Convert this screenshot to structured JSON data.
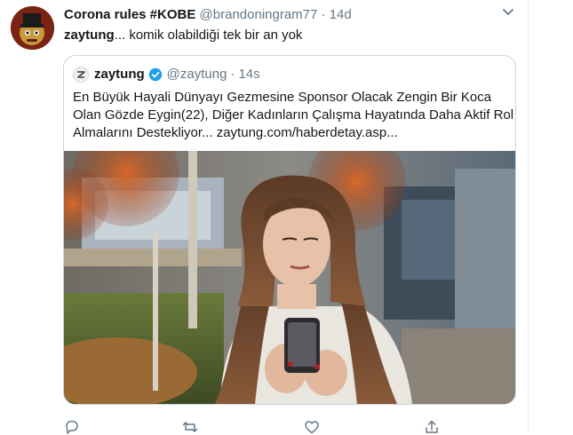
{
  "tweet": {
    "author_name": "Corona rules #KOBE",
    "author_handle": "@brandoningram77",
    "separator": "·",
    "time": "14d",
    "text_mention": "zaytung",
    "text_rest": "... komik olabildiği tek bir an yok"
  },
  "quoted": {
    "name": "zaytung",
    "handle": "@zaytung",
    "separator": "·",
    "time": "14s",
    "lines": [
      "En Büyük Hayali Dünyayı Gezmesine Sponsor Olacak Zengin Bir Koca",
      "Olan Gözde Eygin(22), Diğer Kadınların Çalışma Hayatında Daha Aktif Rol",
      "Almalarını Destekliyor... zaytung.com/haberdetay.asp..."
    ]
  },
  "icons": {
    "menu": "chevron-down-icon",
    "reply": "reply-icon",
    "retweet": "retweet-icon",
    "like": "like-icon",
    "share": "share-icon",
    "verified": "verified-badge-icon"
  },
  "colors": {
    "text": "#14171a",
    "secondary": "#657786",
    "border": "#ccd6dd",
    "verified": "#1da1f2"
  }
}
